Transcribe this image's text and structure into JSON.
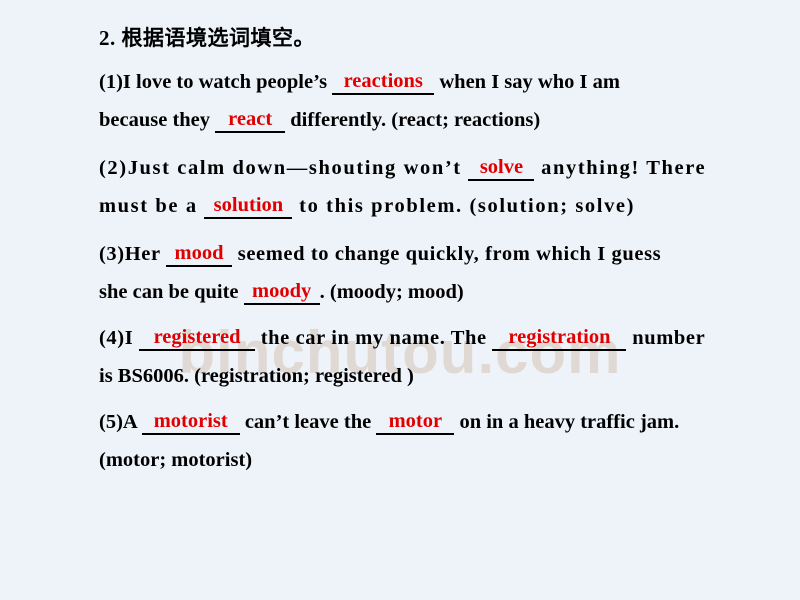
{
  "slide": {
    "background_color": "#eef3fa",
    "text_color": "#000000",
    "answer_color": "#e00000",
    "watermark": "binchutou.com",
    "watermark_color": "#ded5cd"
  },
  "exercise": {
    "title": "2. 根据语境选词填空。",
    "items": [
      {
        "number": "(1)",
        "lines": [
          {
            "segments": [
              {
                "type": "text",
                "value": "(1)I love to watch people’s "
              },
              {
                "type": "blank",
                "value": "reactions"
              },
              {
                "type": "text",
                "value": " when I say who I am"
              }
            ]
          },
          {
            "segments": [
              {
                "type": "text",
                "value": "because they "
              },
              {
                "type": "blank",
                "value": "react"
              },
              {
                "type": "text",
                "value": " differently. (react; reactions)"
              }
            ]
          }
        ],
        "word_bank": "(react; reactions)",
        "answers": [
          "reactions",
          "react"
        ]
      },
      {
        "number": "(2)",
        "lines": [
          {
            "segments": [
              {
                "type": "text",
                "value": "(2)Just calm down—shouting won’t "
              },
              {
                "type": "blank",
                "value": "solve"
              },
              {
                "type": "text",
                "value": " anything! There"
              }
            ]
          },
          {
            "segments": [
              {
                "type": "text",
                "value": "must be a "
              },
              {
                "type": "blank",
                "value": "solution"
              },
              {
                "type": "text",
                "value": " to this problem. (solution; solve)"
              }
            ]
          }
        ],
        "word_bank": "(solution; solve)",
        "answers": [
          "solve",
          "solution"
        ]
      },
      {
        "number": "(3)",
        "lines": [
          {
            "segments": [
              {
                "type": "text",
                "value": "(3)Her "
              },
              {
                "type": "blank",
                "value": "mood"
              },
              {
                "type": "text",
                "value": " seemed to change quickly, from which I guess"
              }
            ]
          },
          {
            "segments": [
              {
                "type": "text",
                "value": "she can be quite "
              },
              {
                "type": "blank",
                "value": "moody"
              },
              {
                "type": "text",
                "value": ". (moody; mood)"
              }
            ]
          }
        ],
        "word_bank": "(moody; mood)",
        "answers": [
          "mood",
          "moody"
        ]
      },
      {
        "number": "(4)",
        "lines": [
          {
            "segments": [
              {
                "type": "text",
                "value": "(4)I "
              },
              {
                "type": "blank",
                "value": "registered"
              },
              {
                "type": "text",
                "value": " the car in my name. The "
              },
              {
                "type": "blank",
                "value": "registration"
              },
              {
                "type": "text",
                "value": " number"
              }
            ]
          },
          {
            "segments": [
              {
                "type": "text",
                "value": "is BS6006. (registration; registered )"
              }
            ]
          }
        ],
        "word_bank": "(registration; registered )",
        "answers": [
          "registered",
          "registration"
        ]
      },
      {
        "number": "(5)",
        "lines": [
          {
            "segments": [
              {
                "type": "text",
                "value": "(5)A "
              },
              {
                "type": "blank",
                "value": "motorist"
              },
              {
                "type": "text",
                "value": " can’t leave the "
              },
              {
                "type": "blank",
                "value": "motor"
              },
              {
                "type": "text",
                "value": " on in a heavy traffic jam."
              }
            ]
          },
          {
            "segments": [
              {
                "type": "text",
                "value": "(motor; motorist)"
              }
            ]
          }
        ],
        "word_bank": "(motor; motorist)",
        "answers": [
          "motorist",
          "motor"
        ]
      }
    ]
  },
  "text_runs": {
    "l1a": "(1)I love to watch people’s ",
    "l1_ans": "reactions",
    "l1b": " when I say who I am",
    "l2a": "because they ",
    "l2_ans": "react",
    "l2b": " differently. (react; reactions)",
    "l3a": "(2)Just calm down—shouting won’t ",
    "l3_ans": "solve",
    "l3b": " anything! There",
    "l4a": "must be a ",
    "l4_ans": "solution",
    "l4b": " to this problem. (solution; solve)",
    "l5a": "(3)Her ",
    "l5_ans": "mood",
    "l5b": " seemed to change quickly, from which I guess",
    "l6a": "she can be quite ",
    "l6_ans": "moody",
    "l6b": ". (moody; mood)",
    "l7a": "(4)I ",
    "l7_ans1": "registered",
    "l7b": " the car in my name. The ",
    "l7_ans2": "registration",
    "l7c": " number",
    "l8": "is BS6006. (registration; registered )",
    "l9a": "(5)A ",
    "l9_ans1": "motorist",
    "l9b": " can’t leave the ",
    "l9_ans2": "motor",
    "l9c": " on in a heavy traffic jam.",
    "l10": "(motor; motorist)"
  }
}
